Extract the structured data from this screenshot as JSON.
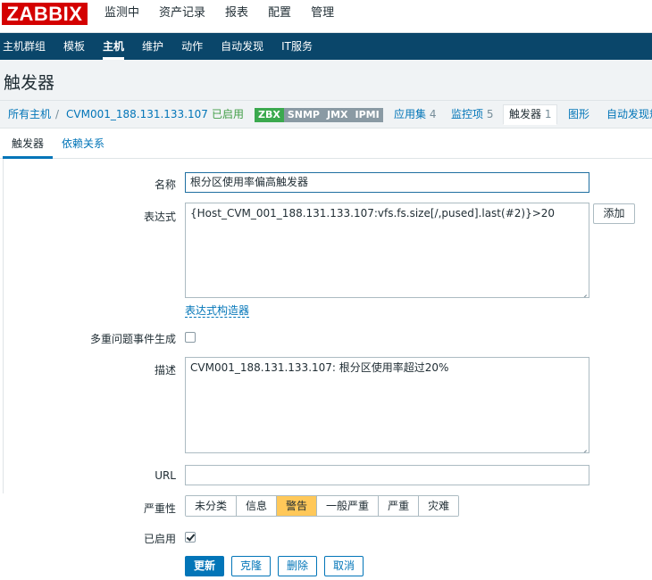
{
  "logo": "ZABBIX",
  "top_menu": [
    "监测中",
    "资产记录",
    "报表",
    "配置",
    "管理"
  ],
  "sub_menu": [
    "主机群组",
    "模板",
    "主机",
    "维护",
    "动作",
    "自动发现",
    "IT服务"
  ],
  "page_title": "触发器",
  "hostbar": {
    "all_hosts": "所有主机",
    "separator": "/",
    "host": "CVM001_188.131.133.107",
    "enabled": "已启用",
    "status": [
      "ZBX",
      "SNMP",
      "JMX",
      "IPMI"
    ],
    "applications": "应用集",
    "applications_count": "4",
    "items": "监控项",
    "items_count": "5",
    "triggers": "触发器",
    "triggers_count": "1",
    "graphs": "图形",
    "discovery": "自动发现规"
  },
  "form_tabs": [
    "触发器",
    "依赖关系"
  ],
  "form": {
    "name_label": "名称",
    "name_value": "根分区使用率偏高触发器",
    "expression_label": "表达式",
    "expression_value": "{Host_CVM_001_188.131.133.107:vfs.fs.size[/,pused].last(#2)}>20",
    "add_button": "添加",
    "expression_builder": "表达式构造器",
    "multiple_label": "多重问题事件生成",
    "description_label": "描述",
    "description_value": "CVM001_188.131.133.107: 根分区使用率超过20%",
    "url_label": "URL",
    "url_value": "",
    "severity_label": "严重性",
    "severity_options": [
      "未分类",
      "信息",
      "警告",
      "一般严重",
      "严重",
      "灾难"
    ],
    "severity_selected": "警告",
    "enabled_label": "已启用"
  },
  "buttons": {
    "update": "更新",
    "clone": "克隆",
    "delete": "删除",
    "cancel": "取消"
  },
  "colors": {
    "brand": "#d40000",
    "subnav": "#0a466a",
    "link": "#0275b8",
    "enabled_green": "#429e47",
    "zbx_green": "#3ba94e",
    "severity_warning": "#ffc859"
  }
}
